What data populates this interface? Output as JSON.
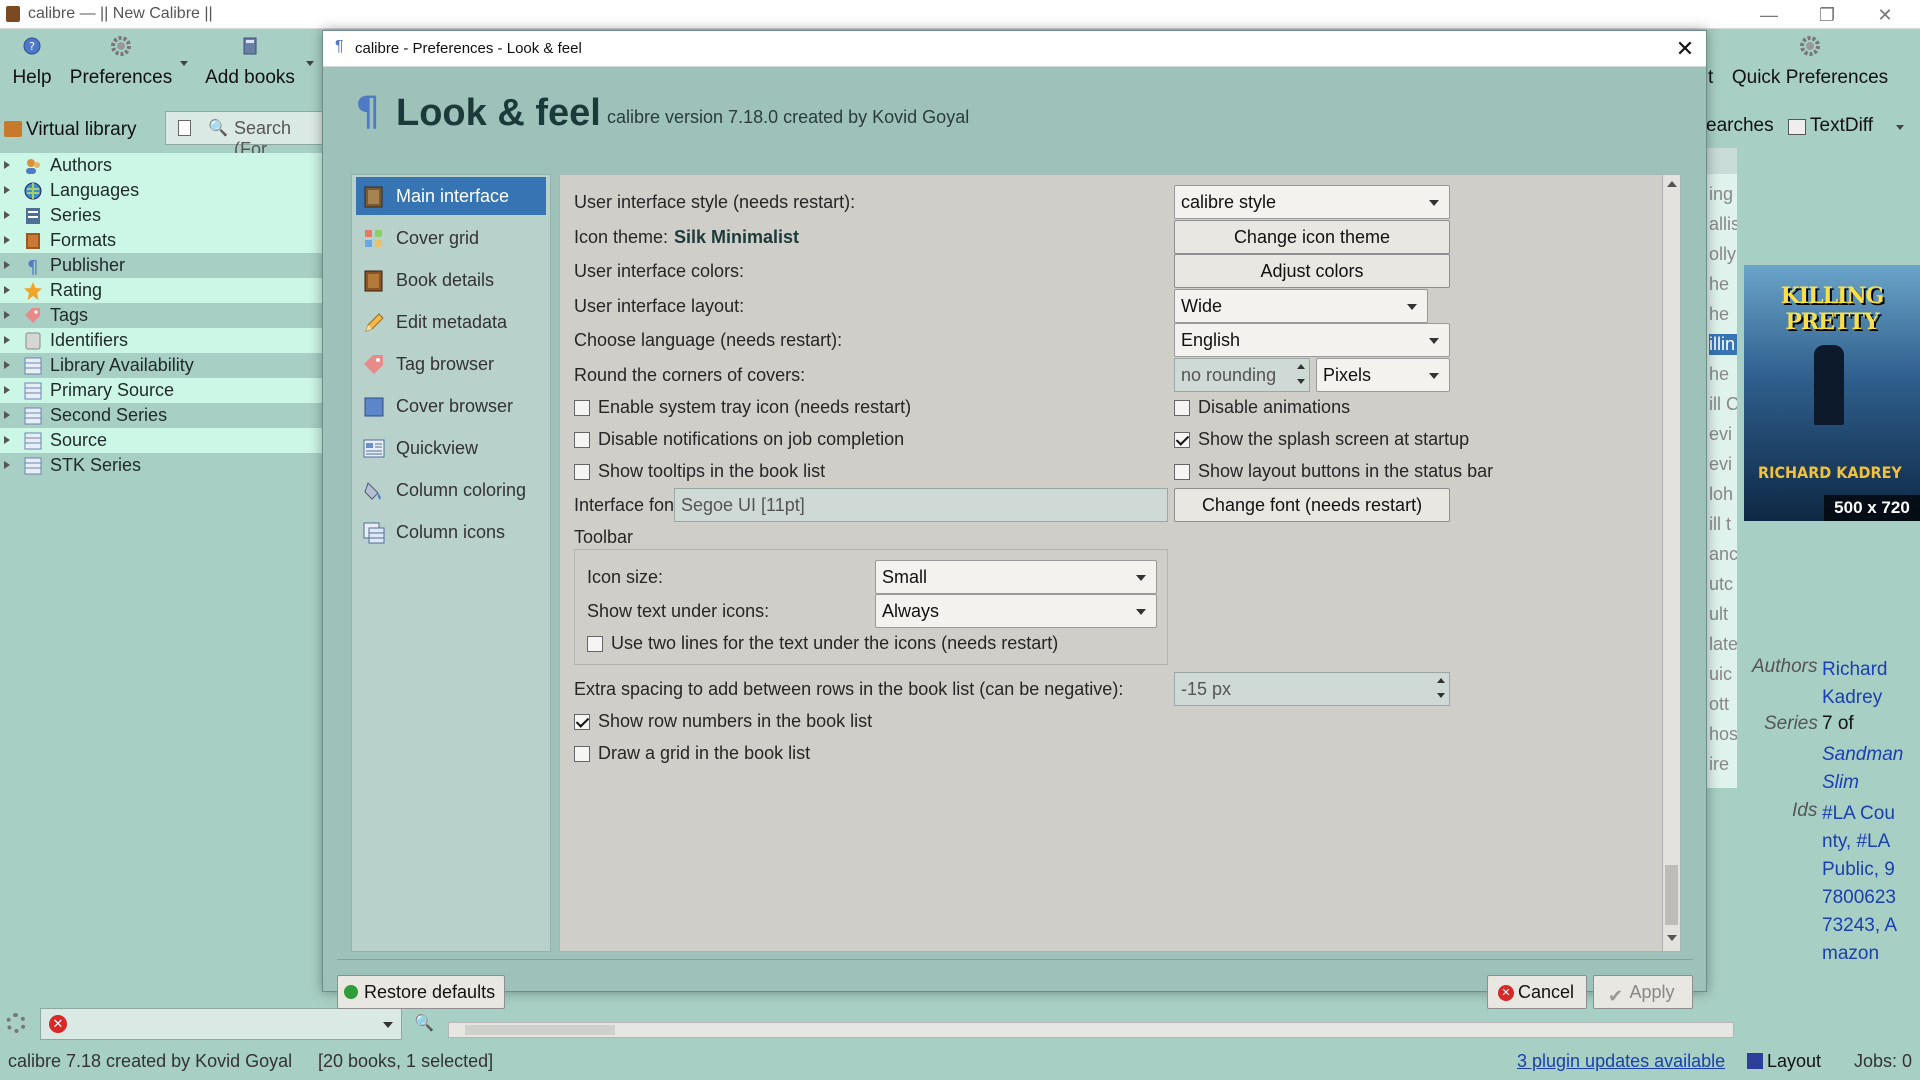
{
  "window": {
    "title": "calibre — || New Calibre ||"
  },
  "toolbar": {
    "help": "Help",
    "preferences": "Preferences",
    "add_books": "Add books",
    "quick_preferences": "Quick Preferences",
    "partial_t": "t"
  },
  "library_bar": {
    "virtual_library": "Virtual library",
    "search_placeholder": "Search (For",
    "searches_partial": "earches",
    "textdiff": "TextDiff"
  },
  "tag_browser": {
    "items": [
      {
        "label": "Authors",
        "icon": "authors-icon"
      },
      {
        "label": "Languages",
        "icon": "languages-icon"
      },
      {
        "label": "Series",
        "icon": "series-icon"
      },
      {
        "label": "Formats",
        "icon": "formats-icon"
      },
      {
        "label": "Publisher",
        "icon": "publisher-icon"
      },
      {
        "label": "Rating",
        "icon": "rating-icon"
      },
      {
        "label": "Tags",
        "icon": "tags-icon"
      },
      {
        "label": "Identifiers",
        "icon": "identifiers-icon"
      },
      {
        "label": "Library Availability",
        "icon": "column-icon"
      },
      {
        "label": "Primary Source",
        "icon": "column-icon"
      },
      {
        "label": "Second Series",
        "icon": "column-icon"
      },
      {
        "label": "Source",
        "icon": "column-icon"
      },
      {
        "label": "STK Series",
        "icon": "column-icon"
      }
    ]
  },
  "dialog": {
    "title": "calibre - Preferences - Look & feel",
    "heading": "Look & feel",
    "version": "calibre version 7.18.0 created by Kovid Goyal",
    "nav": [
      {
        "label": "Main interface",
        "selected": true
      },
      {
        "label": "Cover grid"
      },
      {
        "label": "Book details"
      },
      {
        "label": "Edit metadata"
      },
      {
        "label": "Tag browser"
      },
      {
        "label": "Cover browser"
      },
      {
        "label": "Quickview"
      },
      {
        "label": "Column coloring"
      },
      {
        "label": "Column icons"
      }
    ],
    "ui_style_label": "User interface style (needs restart):",
    "ui_style_value": "calibre style",
    "icon_theme_label": "Icon theme:",
    "icon_theme_value": "Silk Minimalist",
    "change_icon_theme": "Change icon theme",
    "ui_colors_label": "User interface colors:",
    "adjust_colors": "Adjust colors",
    "ui_layout_label": "User interface layout:",
    "ui_layout_value": "Wide",
    "language_label": "Choose language (needs restart):",
    "language_value": "English",
    "round_corners_label": "Round the corners of covers:",
    "round_corners_value": "no rounding",
    "round_units": "Pixels",
    "checkboxes_left": [
      {
        "label": "Enable system tray icon (needs restart)",
        "checked": false
      },
      {
        "label": "Disable notifications on job completion",
        "checked": false
      },
      {
        "label": "Show tooltips in the book list",
        "checked": false
      }
    ],
    "checkboxes_right": [
      {
        "label": "Disable animations",
        "checked": false
      },
      {
        "label": "Show the splash screen at startup",
        "checked": true
      },
      {
        "label": "Show layout buttons in the status bar",
        "checked": false
      }
    ],
    "interface_font_label": "Interface font:",
    "interface_font_value": "Segoe UI [11pt]",
    "change_font": "Change font (needs restart)",
    "toolbar_group_label": "Toolbar",
    "icon_size_label": "Icon size:",
    "icon_size_value": "Small",
    "text_under_icons_label": "Show text under icons:",
    "text_under_icons_value": "Always",
    "two_lines_label": "Use two lines for the text under the icons (needs restart)",
    "two_lines_checked": false,
    "extra_spacing_label": "Extra spacing to add between rows in the book list (can be negative):",
    "extra_spacing_value": "-15 px",
    "row_numbers_label": "Show row numbers in the book list",
    "row_numbers_checked": true,
    "grid_label": "Draw a grid in the book list",
    "grid_checked": false,
    "restore_defaults": "Restore defaults",
    "cancel": "Cancel",
    "apply": "Apply"
  },
  "book_list_partial": [
    "ing",
    "allis",
    "olly",
    "he",
    "he",
    "illin",
    "he",
    "ill C",
    "evi",
    "evi",
    "loh",
    "ill t",
    "anc",
    "utc",
    "ult",
    "late",
    "uic",
    "ott",
    "hos",
    "ire"
  ],
  "cover": {
    "title": "KILLING PRETTY",
    "author": "RICHARD KADREY",
    "size": "500 x 720"
  },
  "book_details": {
    "authors_label": "Authors",
    "authors_value": "Richard Kadrey",
    "series_label": "Series",
    "series_value": "7 of",
    "series_name": "Sandman Slim",
    "ids_label": "Ids",
    "ids_value": "#LA County, #LA Public, 9780062373243, Amazon"
  },
  "status": {
    "left": "calibre 7.18 created by Kovid Goyal",
    "count": "[20 books, 1 selected]",
    "plugin_updates": "3 plugin updates available",
    "layout": "Layout",
    "jobs": "Jobs: 0"
  }
}
